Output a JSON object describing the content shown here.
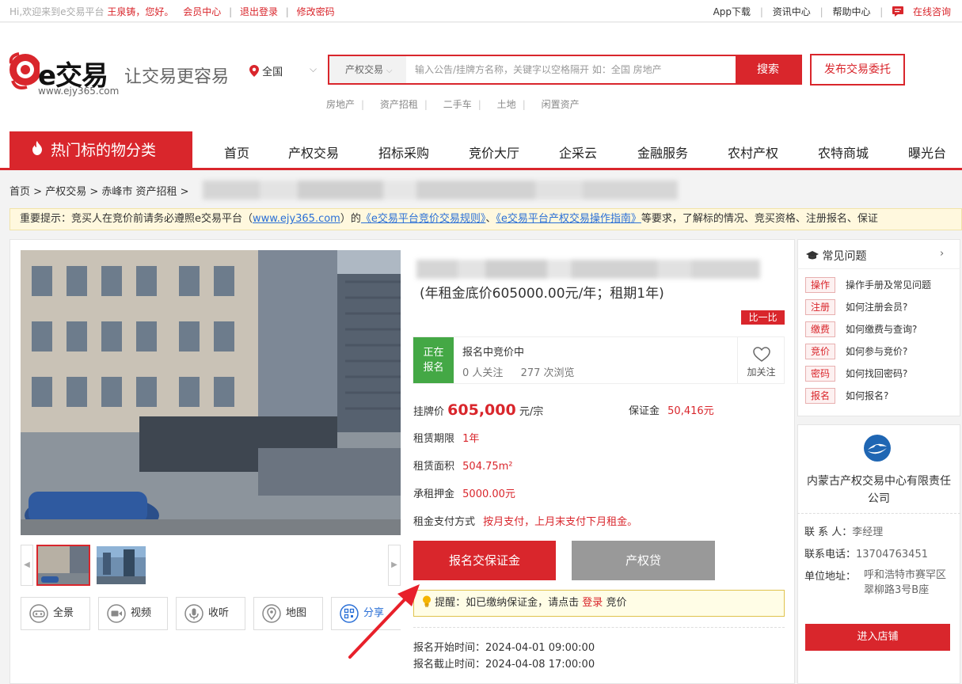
{
  "topbar": {
    "greeting": "Hi,欢迎来到e交易平台",
    "username": "王泉铸，您好。",
    "member_center": "会员中心",
    "logout": "退出登录",
    "change_password": "修改密码",
    "app_download": "App下载",
    "news_center": "资讯中心",
    "help_center": "帮助中心",
    "online_consult": "在线咨询"
  },
  "header": {
    "logo_text": "e交易",
    "logo_url": "www.ejy365.com",
    "slogan": "让交易更容易",
    "location": "全国",
    "search_category": "产权交易",
    "search_placeholder": "输入公告/挂牌方名称，关键字以空格隔开 如：全国 房地产",
    "search_button": "搜索",
    "publish_button": "发布交易委托",
    "quick_links": [
      "房地产",
      "资产招租",
      "二手车",
      "土地",
      "闲置资产"
    ]
  },
  "nav": {
    "hot": "热门标的物分类",
    "items": [
      "首页",
      "产权交易",
      "招标采购",
      "竞价大厅",
      "企采云",
      "金融服务",
      "农村产权",
      "农特商城",
      "曝光台"
    ]
  },
  "breadcrumb": [
    "首页",
    "产权交易",
    "赤峰市 资产招租"
  ],
  "notice": {
    "prefix": "重要提示：竞买人在竞价前请务必遵照e交易平台（",
    "site": "www.ejy365.com",
    "mid": "）的",
    "rule1": "《e交易平台竞价交易规则》",
    "sep": "、",
    "rule2": "《e交易平台产权交易操作指南》",
    "suffix": "等要求，了解标的情况、竞买资格、注册报名、保证"
  },
  "listing": {
    "subtitle": "(年租金底价605000.00元/年；租期1年)",
    "compare": "比一比",
    "status": "正在报名",
    "phase": "报名中竞价中",
    "followers": "0",
    "followers_label": "人关注",
    "views": "277",
    "views_label": "次浏览",
    "follow": "加关注",
    "price_label": "挂牌价",
    "price": "605,000",
    "price_unit": "元/宗",
    "deposit_label": "保证金",
    "deposit": "50,416元",
    "term_label": "租赁期限",
    "term": "1年",
    "area_label": "租赁面积",
    "area": "504.75m²",
    "lease_deposit_label": "承租押金",
    "lease_deposit": "5000.00元",
    "payment_label": "租金支付方式",
    "payment": "按月支付，上月末支付下月租金。",
    "signup_button": "报名交保证金",
    "loan_button": "产权贷",
    "reminder_prefix": "提醒：如已缴纳保证金，请点击",
    "reminder_login": "登录",
    "reminder_suffix": "竞价",
    "start_label": "报名开始时间：",
    "start_time": "2024-04-01 09:00:00",
    "end_label": "报名截止时间：",
    "end_time": "2024-04-08 17:00:00"
  },
  "media_tools": [
    "全景",
    "视频",
    "收听",
    "地图",
    "分享"
  ],
  "faq": {
    "title": "常见问题",
    "items": [
      {
        "tag": "操作",
        "text": "操作手册及常见问题"
      },
      {
        "tag": "注册",
        "text": "如何注册会员?"
      },
      {
        "tag": "缴费",
        "text": "如何缴费与查询?"
      },
      {
        "tag": "竞价",
        "text": "如何参与竞价?"
      },
      {
        "tag": "密码",
        "text": "如何找回密码?"
      },
      {
        "tag": "报名",
        "text": "如何报名?"
      }
    ]
  },
  "org": {
    "name": "内蒙古产权交易中心有限责任公司",
    "contact_label": "联 系 人：",
    "contact": "李经理",
    "phone_label": "联系电话：",
    "phone": "13704763451",
    "address_label": "单位地址：",
    "address": "呼和浩特市赛罕区翠柳路3号B座",
    "shop_button": "进入店铺"
  },
  "colors": {
    "brand_red": "#d9262c",
    "status_green": "#44a845",
    "link_blue": "#2a6fd6"
  }
}
